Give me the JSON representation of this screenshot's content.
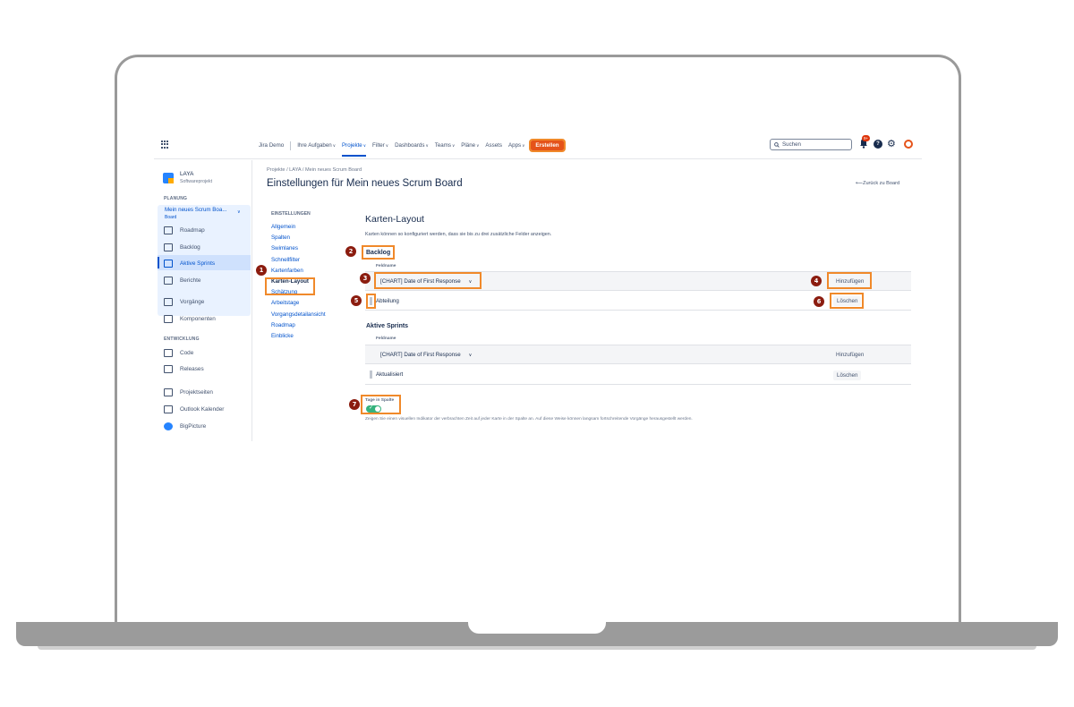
{
  "topnav": {
    "site": "Jira Demo",
    "items": [
      {
        "label": "Ihre Aufgaben",
        "caret": true
      },
      {
        "label": "Projekte",
        "caret": true
      },
      {
        "label": "Filter",
        "caret": true
      },
      {
        "label": "Dashboards",
        "caret": true
      },
      {
        "label": "Teams",
        "caret": true
      },
      {
        "label": "Pläne",
        "caret": true
      },
      {
        "label": "Assets",
        "caret": false
      },
      {
        "label": "Apps",
        "caret": true
      }
    ],
    "create_label": "Erstellen",
    "search_placeholder": "Suchen",
    "notification_count": "9+"
  },
  "sidebar": {
    "project_name": "LAYA",
    "project_type": "Softwareprojekt",
    "planning_label": "PLANUNG",
    "board_name": "Mein neues Scrum Boa...",
    "board_type": "Board",
    "board_items": [
      "Roadmap",
      "Backlog",
      "Aktive Sprints",
      "Berichte"
    ],
    "items_a": [
      "Vorgänge",
      "Komponenten"
    ],
    "development_label": "ENTWICKLUNG",
    "items_b": [
      "Code",
      "Releases"
    ],
    "items_c": [
      "Projektseiten",
      "Outlook Kalender",
      "BigPicture"
    ]
  },
  "header": {
    "breadcrumb": "Projekte  /  LAYA  /  Mein neues Scrum Board",
    "title": "Einstellungen für Mein neues Scrum Board",
    "back_link": "Zurück zu Board"
  },
  "settings_nav": {
    "label": "EINSTELLUNGEN",
    "items": [
      "Allgemein",
      "Spalten",
      "Swimlanes",
      "Schnellfilter",
      "Kartenfarben",
      "Karten-Layout",
      "Schätzung",
      "Arbeitstage",
      "Vorgangsdetailansicht",
      "Roadmap",
      "Einblicke"
    ]
  },
  "content": {
    "title": "Karten-Layout",
    "description": "Karten können so konfiguriert werden, dass sie bis zu drei zusätzliche Felder anzeigen.",
    "backlog": {
      "title": "Backlog",
      "field_header": "Feldname",
      "select_value": "[CHART] Date of First Response",
      "add_label": "Hinzufügen",
      "row_field": "Abteilung",
      "delete_label": "Löschen"
    },
    "sprints": {
      "title": "Aktive Sprints",
      "field_header": "Feldname",
      "select_value": "[CHART] Date of First Response",
      "add_label": "Hinzufügen",
      "row_field": "Aktualisiert",
      "delete_label": "Löschen"
    },
    "toggle": {
      "label": "Tage in Spalte",
      "checked": true,
      "description": "Zeigen Sie einen visuellen Indikator der verbrachten Zeit auf jeder Karte in der Spalte an. Auf diese Weise können langsam fortschreitende Vorgänge herausgestellt werden."
    }
  },
  "annotations": [
    "1",
    "2",
    "3",
    "4",
    "5",
    "6",
    "7"
  ],
  "colors": {
    "accent": "#0052cc",
    "highlight": "#f0892a",
    "badge": "#8b1c0f",
    "create": "#e5531a"
  }
}
